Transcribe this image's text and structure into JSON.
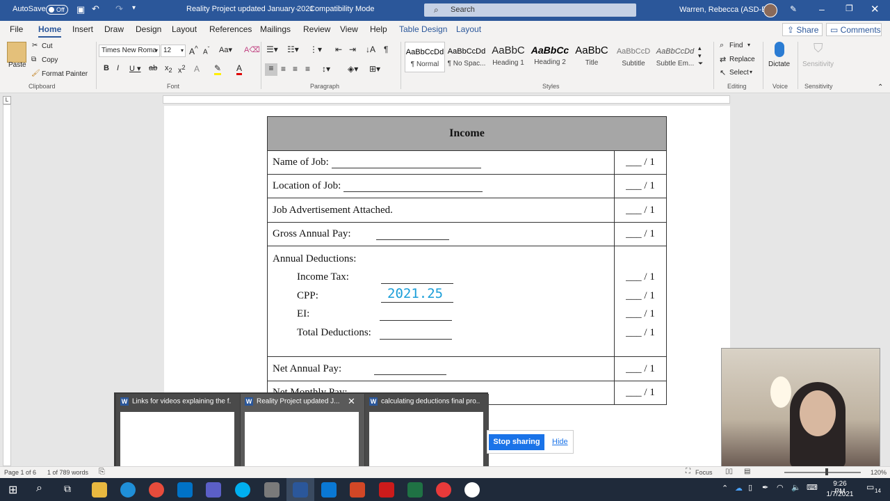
{
  "titlebar": {
    "autosave_label": "AutoSave",
    "autosave_state": "Off",
    "doc_title": "Reality Project updated January 2021",
    "mode": "Compatibility Mode",
    "search_placeholder": "Search",
    "user": "Warren, Rebecca (ASD-E)"
  },
  "menu_tabs": [
    "File",
    "Home",
    "Insert",
    "Draw",
    "Design",
    "Layout",
    "References",
    "Mailings",
    "Review",
    "View",
    "Help",
    "Table Design",
    "Layout"
  ],
  "share_label": "Share",
  "comments_label": "Comments",
  "clipboard": {
    "paste": "Paste",
    "cut": "Cut",
    "copy": "Copy",
    "format_painter": "Format Painter",
    "group": "Clipboard"
  },
  "font": {
    "name": "Times New Roma",
    "size": "12",
    "group": "Font"
  },
  "paragraph_group": "Paragraph",
  "styles": {
    "group": "Styles",
    "items": [
      {
        "preview": "AaBbCcDd",
        "name": "¶ Normal"
      },
      {
        "preview": "AaBbCcDd",
        "name": "¶ No Spac..."
      },
      {
        "preview": "AaBbC",
        "name": "Heading 1"
      },
      {
        "preview": "AaBbCc",
        "name": "Heading 2"
      },
      {
        "preview": "AaBbC",
        "name": "Title"
      },
      {
        "preview": "AaBbCcD",
        "name": "Subtitle"
      },
      {
        "preview": "AaBbCcDd",
        "name": "Subtle Em..."
      }
    ]
  },
  "editing": {
    "find": "Find",
    "replace": "Replace",
    "select": "Select",
    "group": "Editing"
  },
  "voice": {
    "dictate": "Dictate",
    "group": "Voice"
  },
  "sensitivity": {
    "label": "Sensitivity",
    "group": "Sensitivity"
  },
  "table": {
    "header": "Income",
    "rows": [
      {
        "label": "Name of Job:",
        "score": "___ / 1"
      },
      {
        "label": "Location of Job:",
        "score": "___ / 1"
      },
      {
        "label": "Job Advertisement Attached.",
        "score": "___ / 1"
      },
      {
        "label": "Gross Annual Pay:",
        "score": "___ / 1"
      },
      {
        "label": "Annual Deductions:",
        "score": ""
      },
      {
        "label": "Income Tax:",
        "score": "___ / 1"
      },
      {
        "label": "CPP:",
        "score": "___ / 1",
        "handwritten": "2021.25"
      },
      {
        "label": "EI:",
        "score": "___ / 1"
      },
      {
        "label": "Total Deductions:",
        "score": "___ / 1"
      },
      {
        "label": "Net Annual Pay:",
        "score": "___ / 1"
      },
      {
        "label": "Net Monthly Pay:",
        "score": "___ / 1"
      }
    ]
  },
  "thumbnails": [
    {
      "title": "Links for videos explaining the f..."
    },
    {
      "title": "Reality Project updated J..."
    },
    {
      "title": "calculating deductions final pro..."
    }
  ],
  "share_bar": {
    "stop": "Stop sharing",
    "hide": "Hide"
  },
  "status": {
    "page": "Page 1 of 6",
    "words": "1 of 789 words",
    "focus": "Focus",
    "zoom": "120%"
  },
  "clock": {
    "time": "9:26 PM",
    "date": "1/7/2021",
    "notifications": "14"
  },
  "colors": {
    "accent": "#2b579a",
    "header_fill": "#a6a6a6",
    "handwriting": "#1a9ed8"
  }
}
